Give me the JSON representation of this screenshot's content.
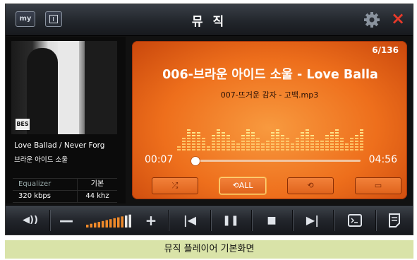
{
  "titlebar": {
    "my_label": "my",
    "title": "뮤 직",
    "close_symbol": "×"
  },
  "left_panel": {
    "album_logo": "BES",
    "song_line": "Love Ballad / Never Forg",
    "artist_line": "브라운 아이드 소울",
    "info": [
      {
        "label": "Equalizer",
        "value": "기본"
      },
      {
        "label": "320 kbps",
        "value": "44 khz"
      }
    ]
  },
  "now_playing": {
    "track_count": "6/136",
    "title": "006-브라운 아이드 소울 - Love Balla",
    "next": "007-뜨거운 감자 - 고백.mp3",
    "elapsed": "00:07",
    "duration": "04:56",
    "progress": 0.02,
    "controls": [
      {
        "name": "shuffle-button",
        "icon": "shuffle-icon",
        "glyph": "⤮",
        "active": false
      },
      {
        "name": "repeat-all-button",
        "icon": "repeat-all-icon",
        "glyph": "⟲ALL",
        "active": true
      },
      {
        "name": "repeat-button",
        "icon": "repeat-icon",
        "glyph": "⟲",
        "active": false
      },
      {
        "name": "folder-button",
        "icon": "folder-icon",
        "glyph": "▭",
        "active": false
      }
    ]
  },
  "bottombar": {
    "volume_icon": "speaker-icon",
    "volume_level": 0.85,
    "glyphs": {
      "volume": "◀))",
      "minus": "—",
      "plus": "+",
      "prev": "|◀",
      "pause": "❚❚",
      "stop": "■",
      "next": "▶|"
    }
  },
  "caption": "뮤직 플레이어 기본화면",
  "colors": {
    "accent": "#ee6f1c",
    "close": "#e83a2a",
    "caption_bg": "#d9e3a8"
  }
}
